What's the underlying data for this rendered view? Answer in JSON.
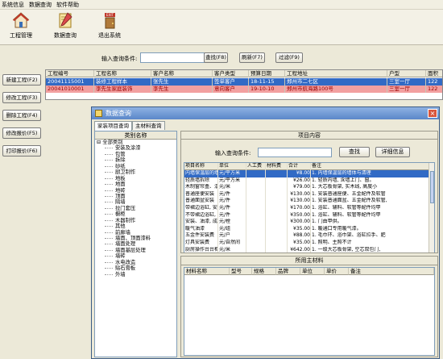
{
  "menubar": {
    "items": [
      "系统信息",
      "数据查询",
      "软件帮助"
    ]
  },
  "toolbar": {
    "buttons": [
      {
        "label": "工程管理",
        "icon": "house-icon"
      },
      {
        "label": "数据查询",
        "icon": "pencil-ruler-icon"
      },
      {
        "label": "退出系统",
        "icon": "exit-door-icon"
      }
    ],
    "exit_sign": "EXIT"
  },
  "sidebar": {
    "buttons": [
      "新建工程(F2)",
      "修改工程(F3)",
      "删除工程(F4)",
      "修改报价(F5)",
      "打印报价(F6)"
    ]
  },
  "search": {
    "label": "输入查询条件:",
    "value": "",
    "buttons": [
      "查找(F8)",
      "刷新(F7)",
      "过滤(F9)"
    ]
  },
  "projects": {
    "columns": [
      "工程编号",
      "工程名称",
      "客户名称",
      "客户类型",
      "预算日期",
      "工程地址",
      "户型",
      "面积"
    ],
    "rows": [
      [
        "20041115001",
        "装修工程样本",
        "张先生",
        "签单客户",
        "18-11-15",
        "郑州市二七区",
        "三室一厅",
        "122"
      ],
      [
        "20041010001",
        "李先生家庭装饰",
        "李先生",
        "意向客户",
        "19-10-10",
        "郑州市航海路100号",
        "三室一厅",
        "122"
      ]
    ]
  },
  "dialog": {
    "title": "数据查询",
    "close": "×",
    "tabs": [
      "家装项目查询",
      "主材料查询"
    ],
    "tree": {
      "header": "类别名称",
      "root": "全部类别",
      "items": [
        "安装及涂漆",
        "包管",
        "拆除",
        "砂纸",
        "厨卫制作",
        "地板",
        "地面",
        "地砖",
        "顶面",
        "隔墙",
        "拉门套压",
        "橱柜",
        "木器制作",
        "其他",
        "前廊墙",
        "墙面、顶面漆料",
        "墙面处理",
        "墙面基层处理",
        "墙砖",
        "水电改造",
        "贴石膏板",
        "外墙"
      ]
    },
    "project_panel": {
      "header": "项目内容",
      "search_label": "输入查询条件:",
      "search_value": "",
      "find_button": "查找",
      "detail_button": "详细信息",
      "columns": [
        "项目名称",
        "单位",
        "人工费",
        "材料费",
        "合计",
        "备注"
      ],
      "rows": [
        [
          "内墙保温层的墙体",
          "元/平方米",
          "",
          "",
          "¥8.00",
          "1. 内墙保温层的墙体与清理"
        ],
        [
          "轻质墙拆除",
          "元/平方米",
          "",
          "",
          "¥26.00",
          "1. 轻质内墙, 含墙上门、窗。"
        ],
        [
          "木制窗帘盒、混油饰面",
          "元/米",
          "",
          "",
          "¥79.00",
          "1. 大芯板骨架, 实木线, 高度小"
        ],
        [
          "普通座便安装",
          "元/件",
          "",
          "",
          "¥130.00",
          "1. 安装普通座便、五金配件及软管"
        ],
        [
          "普通面盆安装",
          "元/件",
          "",
          "",
          "¥130.00",
          "1. 安装普通面盆、五金配件及软管,"
        ],
        [
          "带裙边浴缸, 安装工费",
          "元/件",
          "",
          "",
          "¥170.00",
          "1. 浴缸、辅料、软管等配件均甲"
        ],
        [
          "不带裙边浴缸, 安装工费",
          "元/件",
          "",
          "",
          "¥350.00",
          "1. 浴缸、辅料、软管等配件均甲"
        ],
        [
          "安装、油漆, 成品门",
          "元/樘",
          "",
          "",
          "¥300.00",
          "1. 门由甲供。"
        ],
        [
          "暖气油漆",
          "元/组",
          "",
          "",
          "¥35.00",
          "1. 暖通口专用暖气漆。"
        ],
        [
          "五金件安装费",
          "元/户",
          "",
          "",
          "¥88.00",
          "1. 毛巾环、浴巾架、浴缸拉手、肥"
        ],
        [
          "灯具安装费",
          "元/自然间",
          "",
          "",
          "¥35.00",
          "1. 照明、主照不计"
        ],
        [
          "厨房操作台台柜",
          "元/米",
          "",
          "",
          "¥642.00",
          "1. 一级大芯板骨架, 空芯双包门,"
        ],
        [
          "卫生间吊柜台柜",
          "元/米",
          "",
          "",
          "¥642.00",
          "1. 一级大芯板骨架, 空芯双包门,"
        ],
        [
          "厨房吊柜",
          "元/米",
          "",
          "",
          "¥642.00",
          "1. 一级大芯板骨架, 空芯双包门,"
        ],
        [
          "卫生间吊柜",
          "元/米",
          "",
          "",
          "¥642.00",
          "1. 一级大芯板骨架, 空芯双包门,"
        ]
      ]
    },
    "materials_panel": {
      "header": "所用主材料",
      "columns": [
        "材料名称",
        "型号",
        "规格",
        "品牌",
        "单位",
        "单价",
        "备注"
      ]
    }
  }
}
